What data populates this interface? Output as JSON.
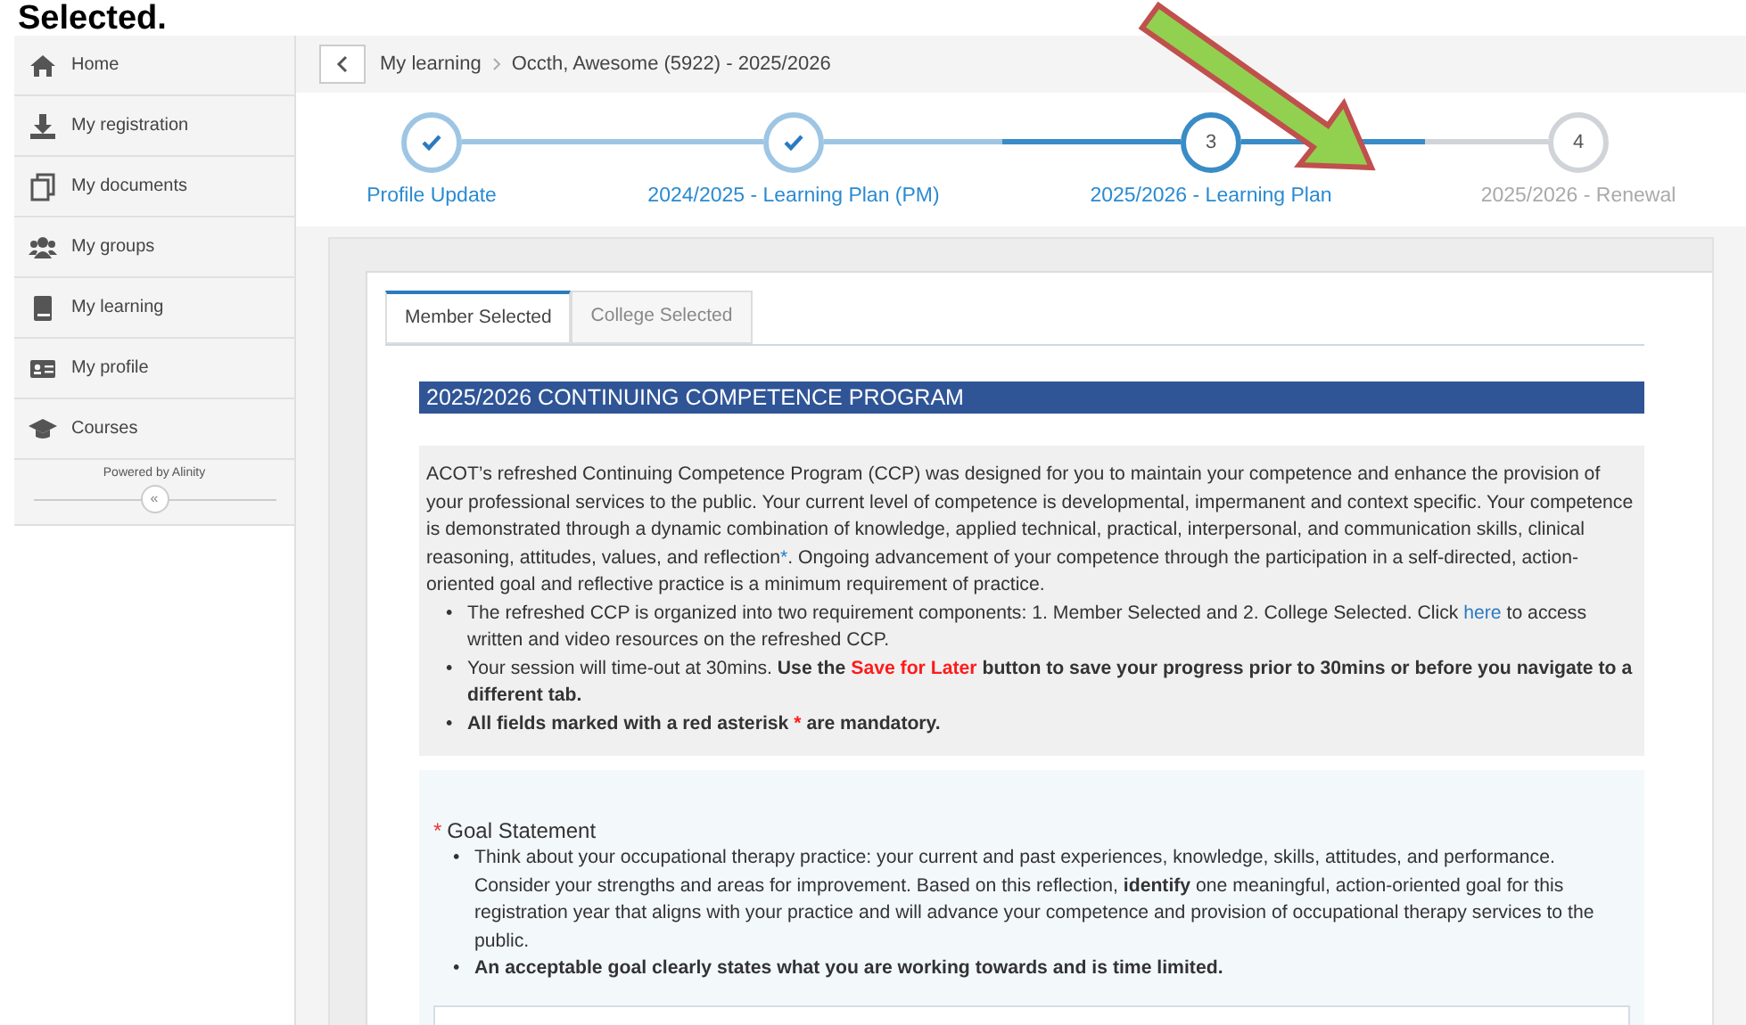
{
  "heading": "Selected.",
  "sidebar": {
    "items": [
      {
        "label": "Home"
      },
      {
        "label": "My registration"
      },
      {
        "label": "My documents"
      },
      {
        "label": "My groups"
      },
      {
        "label": "My learning"
      },
      {
        "label": "My profile"
      },
      {
        "label": "Courses"
      }
    ],
    "powered_by": "Powered by Alinity",
    "collapse": "«"
  },
  "breadcrumb": [
    "My learning",
    "Occth, Awesome (5922) - 2025/2026"
  ],
  "steps": [
    {
      "label": "Profile Update",
      "completed": true,
      "active": false
    },
    {
      "label": "2024/2025 - Learning Plan (PM)",
      "completed": true,
      "active": false
    },
    {
      "label": "2025/2026 - Learning Plan",
      "completed": false,
      "active": true,
      "number": "3"
    },
    {
      "label": "2025/2026 - Renewal",
      "completed": false,
      "active": false,
      "number": "4"
    }
  ],
  "tabs": [
    {
      "label": "Member Selected",
      "selected": true
    },
    {
      "label": "College Selected",
      "selected": false
    }
  ],
  "section_title": "2025/2026 CONTINUING COMPETENCE PROGRAM",
  "intro": [
    {
      "kind": "text",
      "text": "ACOT’s refreshed Continuing Competence Program (CCP) was designed for you to maintain your competence and enhance the provision of your professional services to the public. Your current level of competence is developmental, impermanent and context specific. Your competence is demonstrated through a dynamic combination of knowledge, applied technical, practical, interpersonal, and communication skills, clinical reasoning, attitudes, values, and reflection"
    },
    {
      "kind": "link",
      "text": "*"
    },
    {
      "kind": "text",
      "text": ". Ongoing advancement of your competence through the participation in a self-directed, action-oriented goal and reflective practice is a minimum requirement of practice."
    }
  ],
  "bullets": [
    {
      "marker": "•",
      "parts": [
        {
          "kind": "text",
          "text": "The refreshed CCP is organized into two requirement components: 1. Member Selected and 2. College Selected. Click "
        },
        {
          "kind": "link",
          "text": "here"
        },
        {
          "kind": "text",
          "text": " to access written and video resources on the refreshed CCP."
        }
      ]
    },
    {
      "marker": "•",
      "parts": [
        {
          "kind": "text",
          "text": "Your session will time-out at 30mins. "
        },
        {
          "kind": "bold",
          "text": "Use the "
        },
        {
          "kind": "red",
          "text": "Save for Later"
        },
        {
          "kind": "bold",
          "text": " button to save your progress prior to 30mins or before you navigate to a different tab."
        }
      ]
    },
    {
      "marker": "•",
      "parts": [
        {
          "kind": "bold",
          "text": "All fields marked with a red asterisk "
        },
        {
          "kind": "red",
          "text": "*"
        },
        {
          "kind": "bold",
          "text": " are mandatory."
        }
      ]
    }
  ],
  "goal": {
    "required_mark": "*",
    "label": "Goal Statement",
    "bullets": [
      {
        "marker": "•",
        "parts": [
          {
            "kind": "text",
            "text": "Think about your occupational therapy practice: your current and past experiences, knowledge, skills, attitudes, and performance. Consider your strengths and areas for improvement. Based on this reflection, "
          },
          {
            "kind": "bold",
            "text": "identify"
          },
          {
            "kind": "text",
            "text": " one meaningful, action-oriented goal for this registration year that aligns with your practice and will advance your competence and provision of occupational therapy services to the public."
          }
        ]
      },
      {
        "marker": "•",
        "parts": [
          {
            "kind": "bold",
            "text": "An acceptable goal clearly states what you are working towards and is time limited."
          }
        ]
      }
    ]
  }
}
